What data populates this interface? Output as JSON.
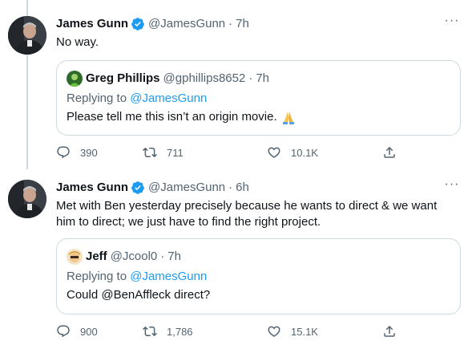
{
  "tweets": [
    {
      "author_name": "James Gunn",
      "handle": "@JamesGunn",
      "separator": "·",
      "time": "7h",
      "text": "No way.",
      "quote": {
        "author_name": "Greg Phillips",
        "handle": "@gphillips8652",
        "separator": "·",
        "time": "7h",
        "replying_label": "Replying to ",
        "replying_handle": "@JamesGunn",
        "text": "Please tell me this isn’t an origin movie.",
        "emoji_icon": "folded-hands-emoji"
      },
      "replies": "390",
      "retweets": "711",
      "likes": "10.1K"
    },
    {
      "author_name": "James Gunn",
      "handle": "@JamesGunn",
      "separator": "·",
      "time": "6h",
      "text": "Met with Ben yesterday precisely because he wants to direct & we want him to direct; we just have to find the right project.",
      "quote": {
        "author_name": "Jeff",
        "handle": "@Jcool0",
        "separator": "·",
        "time": "7h",
        "replying_label": "Replying to ",
        "replying_handle": "@JamesGunn",
        "text": "Could @BenAffleck direct?"
      },
      "replies": "900",
      "retweets": "1,786",
      "likes": "15.1K"
    }
  ],
  "icons": {
    "verified": "verified-badge-icon",
    "more": "more-options-icon",
    "reply": "reply-icon",
    "retweet": "retweet-icon",
    "like": "heart-icon",
    "share": "share-icon"
  },
  "colors": {
    "text": "#0f1419",
    "secondary": "#536471",
    "accent": "#1d9bf0",
    "border": "#cfd9de"
  }
}
